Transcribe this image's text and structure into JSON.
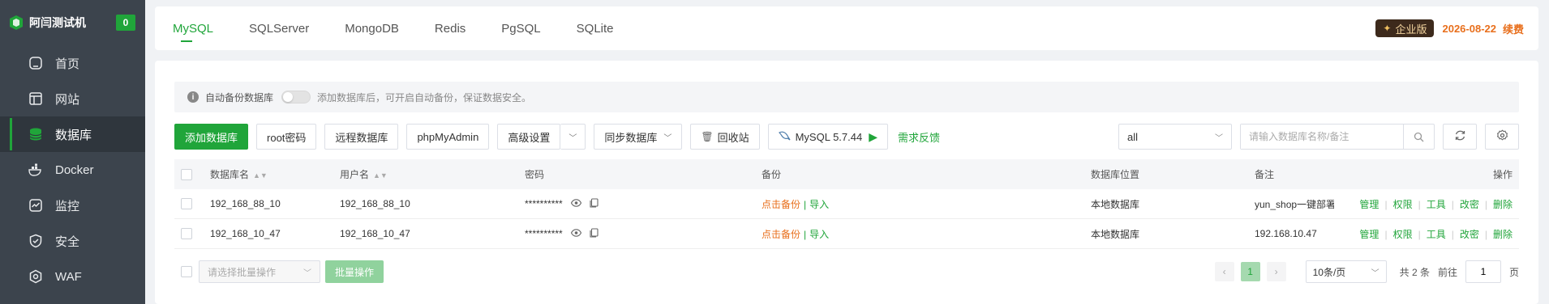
{
  "sidebar": {
    "brand_name": "阿闫测试机",
    "brand_badge": "0",
    "items": [
      {
        "label": "首页",
        "icon": "home-icon"
      },
      {
        "label": "网站",
        "icon": "website-icon"
      },
      {
        "label": "数据库",
        "icon": "database-icon",
        "active": true
      },
      {
        "label": "Docker",
        "icon": "docker-icon"
      },
      {
        "label": "监控",
        "icon": "monitor-icon"
      },
      {
        "label": "安全",
        "icon": "shield-icon"
      },
      {
        "label": "WAF",
        "icon": "waf-icon"
      }
    ]
  },
  "tabs": [
    "MySQL",
    "SQLServer",
    "MongoDB",
    "Redis",
    "PgSQL",
    "SQLite"
  ],
  "header": {
    "edition": "企业版",
    "expiry": "2026-08-22",
    "renew": "续费"
  },
  "notice": {
    "label": "自动备份数据库",
    "hint": "添加数据库后，可开启自动备份，保证数据安全。"
  },
  "toolbar": {
    "add": "添加数据库",
    "root_pwd": "root密码",
    "remote": "远程数据库",
    "phpmyadmin": "phpMyAdmin",
    "advanced": "高级设置",
    "sync": "同步数据库",
    "recycle": "回收站",
    "version": "MySQL 5.7.44",
    "feedback": "需求反馈",
    "filter_value": "all",
    "search_placeholder": "请输入数据库名称/备注"
  },
  "table": {
    "headers": {
      "name": "数据库名",
      "user": "用户名",
      "password": "密码",
      "backup": "备份",
      "location": "数据库位置",
      "note": "备注",
      "ops": "操作"
    },
    "rows": [
      {
        "name": "192_168_88_10",
        "user": "192_168_88_10",
        "password": "**********",
        "backup": "点击备份",
        "import": "导入",
        "location": "本地数据库",
        "note": "yun_shop一键部署"
      },
      {
        "name": "192_168_10_47",
        "user": "192_168_10_47",
        "password": "**********",
        "backup": "点击备份",
        "import": "导入",
        "location": "本地数据库",
        "note": "192.168.10.47"
      }
    ],
    "ops": [
      "管理",
      "权限",
      "工具",
      "改密",
      "删除"
    ]
  },
  "footer": {
    "batch_placeholder": "请选择批量操作",
    "batch_button": "批量操作",
    "page": "1",
    "page_size": "10条/页",
    "total": "共 2 条",
    "goto_label": "前往",
    "goto_value": "1",
    "page_suffix": "页"
  },
  "colors": {
    "accent": "#20a53a",
    "sidebar_bg": "#3c444d",
    "warning": "#e86f1c"
  }
}
